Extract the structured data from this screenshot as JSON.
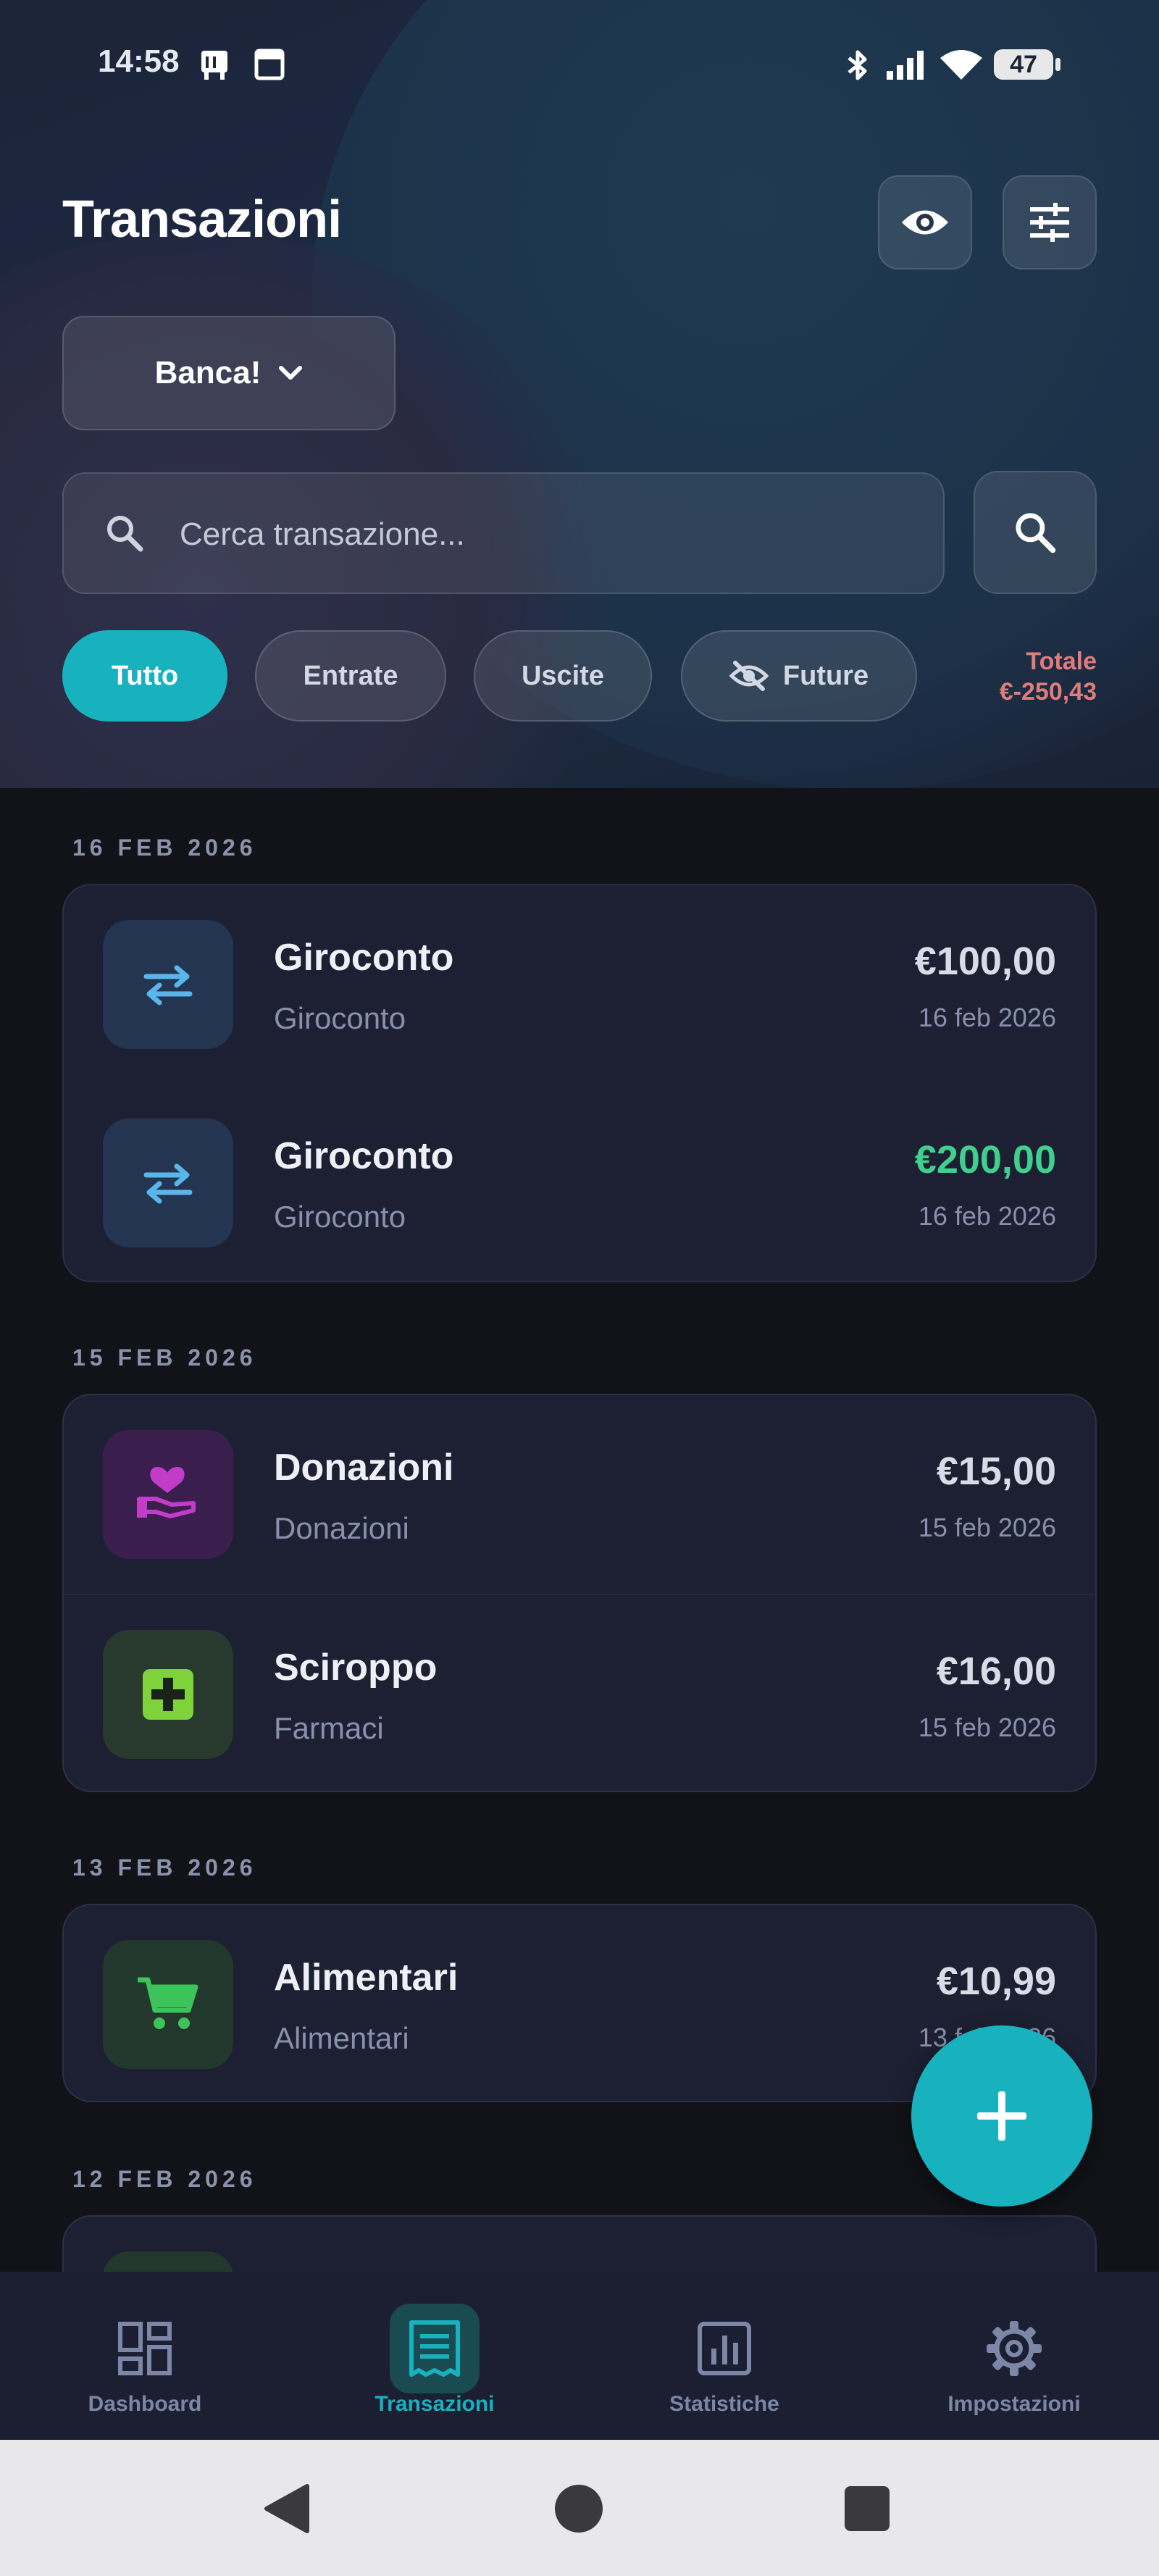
{
  "status_bar": {
    "time": "14:58",
    "battery": "47"
  },
  "header": {
    "title": "Transazioni",
    "account_selector": "Banca!",
    "search": {
      "placeholder": "Cerca transazione..."
    },
    "filters": [
      "Tutto",
      "Entrate",
      "Uscite",
      "Future"
    ],
    "active_filter": "Tutto",
    "total": {
      "label": "Totale",
      "value": "€-250,43"
    }
  },
  "groups": [
    {
      "date": "16 FEB 2026",
      "transactions": [
        {
          "name": "Giroconto",
          "category": "Giroconto",
          "amount": "€100,00",
          "date": "16 feb 2026",
          "icon": "transfer-icon",
          "positive": false
        },
        {
          "name": "Giroconto",
          "category": "Giroconto",
          "amount": "€200,00",
          "date": "16 feb 2026",
          "icon": "transfer-icon",
          "positive": true
        }
      ]
    },
    {
      "date": "15 FEB 2026",
      "transactions": [
        {
          "name": "Donazioni",
          "category": "Donazioni",
          "amount": "€15,00",
          "date": "15 feb 2026",
          "icon": "donation-icon",
          "positive": false
        },
        {
          "name": "Sciroppo",
          "category": "Farmaci",
          "amount": "€16,00",
          "date": "15 feb 2026",
          "icon": "medical-cross-icon",
          "positive": false
        }
      ]
    },
    {
      "date": "13 FEB 2026",
      "transactions": [
        {
          "name": "Alimentari",
          "category": "Alimentari",
          "amount": "€10,99",
          "date": "13 feb 2026",
          "icon": "cart-icon",
          "positive": false
        }
      ]
    },
    {
      "date": "12 FEB 2026",
      "transactions": []
    }
  ],
  "bottom_nav": [
    {
      "label": "Dashboard",
      "icon": "dashboard-icon"
    },
    {
      "label": "Transazioni",
      "icon": "receipt-icon",
      "active": true
    },
    {
      "label": "Statistiche",
      "icon": "chart-icon"
    },
    {
      "label": "Impostazioni",
      "icon": "gear-icon"
    }
  ],
  "colors": {
    "accent": "#17b2be",
    "positive": "#3fcf8e",
    "negative_total": "#e07c7c",
    "background": "#111318",
    "card": "#1d2032"
  }
}
